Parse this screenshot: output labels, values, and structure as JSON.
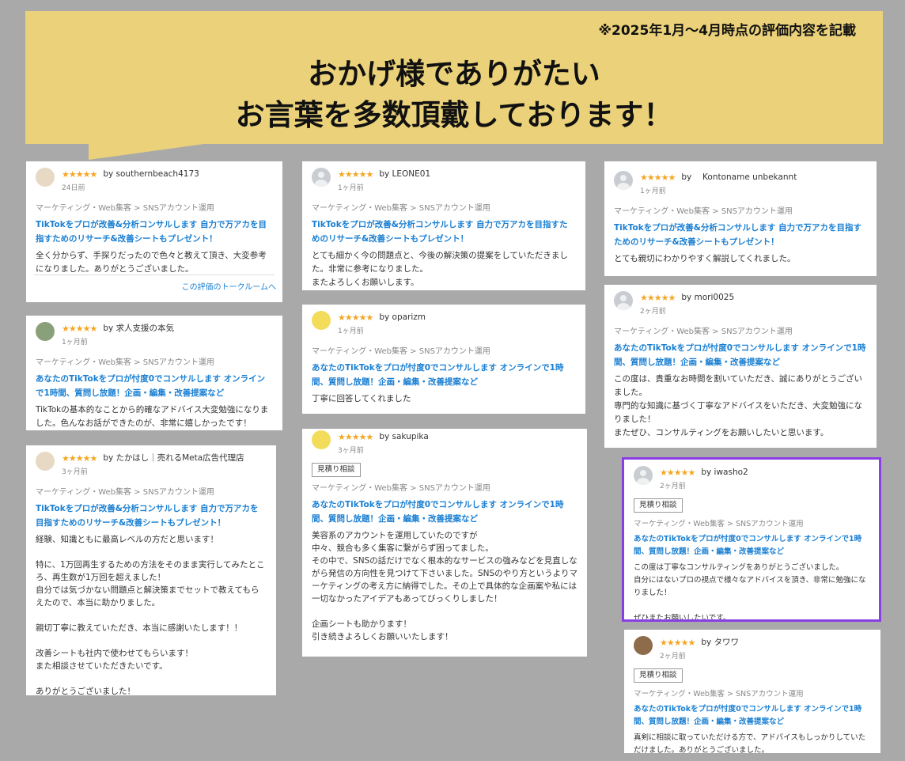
{
  "banner": {
    "note": "※2025年1月〜4月時点の評価内容を記載",
    "headline_line1": "おかげ様でありがたい",
    "headline_line2": "お言葉を多数頂戴しております！"
  },
  "stars": "★★★★★",
  "reviews": [
    {
      "by": "by southernbeach4173",
      "date": "24日前",
      "badge": "",
      "category": "マーケティング・Web集客 > SNSアカウント運用",
      "title": "TikTokをプロが改善&分析コンサルします 自力で万アカを目指すためのリサーチ&改善シートもプレゼント！",
      "body": "全く分からず、手探りだったので色々と教えて頂き、大変参考になりました。ありがとうございました。",
      "link": "この評価のトークルームへ"
    },
    {
      "by": "by 求人支援の本気",
      "date": "1ヶ月前",
      "badge": "",
      "category": "マーケティング・Web集客 > SNSアカウント運用",
      "title": "あなたのTikTokをプロが忖度0でコンサルします オンラインで1時間、質問し放題！企画・編集・改善提案など",
      "body": "TikTokの基本的なことから的確なアドバイス大変勉強になりました。色んなお話ができたのが、非常に嬉しかったです！\nまた次回もよろしくお願いいたします！",
      "link": ""
    },
    {
      "by": "by たかはし｜売れるMeta広告代理店",
      "date": "3ヶ月前",
      "badge": "",
      "category": "マーケティング・Web集客 > SNSアカウント運用",
      "title": "TikTokをプロが改善&分析コンサルします 自力で万アカを目指すためのリサーチ&改善シートもプレゼント！",
      "body": "経験、知識ともに最高レベルの方だと思います！\n\n特に、1万回再生するための方法をそのまま実行してみたところ、再生数が1万回を超えました！\n自分では気づかない問題点と解決策までセットで教えてもらえたので、本当に助かりました。\n\n親切丁寧に教えていただき、本当に感謝いたします！！\n\n改善シートも社内で使わせてもらいます！\nまた相談させていただきたいです。\n\nありがとうございました！",
      "link": ""
    },
    {
      "by": "by LEONE01",
      "date": "1ヶ月前",
      "badge": "",
      "category": "マーケティング・Web集客 > SNSアカウント運用",
      "title": "TikTokをプロが改善&分析コンサルします 自力で万アカを目指すためのリサーチ&改善シートもプレゼント！",
      "body": "とても細かく今の問題点と、今後の解決策の提案をしていただきました。非常に参考になりました。\nまたよろしくお願いします。",
      "link": ""
    },
    {
      "by": "by oparizm",
      "date": "1ヶ月前",
      "badge": "",
      "category": "マーケティング・Web集客 > SNSアカウント運用",
      "title": "あなたのTikTokをプロが忖度0でコンサルします オンラインで1時間、質問し放題！企画・編集・改善提案など",
      "body": "丁寧に回答してくれました",
      "link": ""
    },
    {
      "by": "by sakupika",
      "date": "3ヶ月前",
      "badge": "見積り相談",
      "category": "マーケティング・Web集客 > SNSアカウント運用",
      "title": "あなたのTikTokをプロが忖度0でコンサルします オンラインで1時間、質問し放題！企画・編集・改善提案など",
      "body": "美容系のアカウントを運用していたのですが\n中々、競合も多く集客に繋がらず困ってました。\nその中で、SNSの話だけでなく根本的なサービスの強みなどを見直しながら発信の方向性を見つけて下さいました。SNSのやり方というよりマーケティングの考え方に納得でした。その上で具体的な企画案や私には一切なかったアイデアもあってびっくりしました！\n\n企画シートも助かります！\n引き続きよろしくお願いいたします！",
      "link": ""
    },
    {
      "by": "by 　Kontoname unbekannt",
      "date": "1ヶ月前",
      "badge": "",
      "category": "マーケティング・Web集客 > SNSアカウント運用",
      "title": "TikTokをプロが改善&分析コンサルします 自力で万アカを目指すためのリサーチ&改善シートもプレゼント！",
      "body": "とても親切にわかりやすく解説してくれました。",
      "link": ""
    },
    {
      "by": "by mori0025",
      "date": "2ヶ月前",
      "badge": "",
      "category": "マーケティング・Web集客 > SNSアカウント運用",
      "title": "あなたのTikTokをプロが忖度0でコンサルします オンラインで1時間、質問し放題！企画・編集・改善提案など",
      "body": "この度は、貴重なお時間を割いていただき、誠にありがとうございました。\n専門的な知識に基づく丁寧なアドバイスをいただき、大変勉強になりました！\nまたぜひ、コンサルティングをお願いしたいと思います。",
      "link": ""
    },
    {
      "by": "by iwasho2",
      "date": "2ヶ月前",
      "badge": "見積り相談",
      "category": "マーケティング・Web集客 > SNSアカウント運用",
      "title": "あなたのTikTokをプロが忖度0でコンサルします オンラインで1時間、質問し放題！企画・編集・改善提案など",
      "body": "この度は丁寧なコンサルティングをありがとうございました。\n自分にはないプロの視点で様々なアドバイスを頂き、非常に勉強になりました！\n\nぜひまたお願いしたいです。",
      "link": ""
    },
    {
      "by": "by タワワ",
      "date": "2ヶ月前",
      "badge": "見積り相談",
      "category": "マーケティング・Web集客 > SNSアカウント運用",
      "title": "あなたのTikTokをプロが忖度0でコンサルします オンラインで1時間、質問し放題！企画・編集・改善提案など",
      "body": "真剣に相談に取っていただける方で、アドバイスもしっかりしていただけました。ありがとうございました。",
      "link": ""
    }
  ]
}
